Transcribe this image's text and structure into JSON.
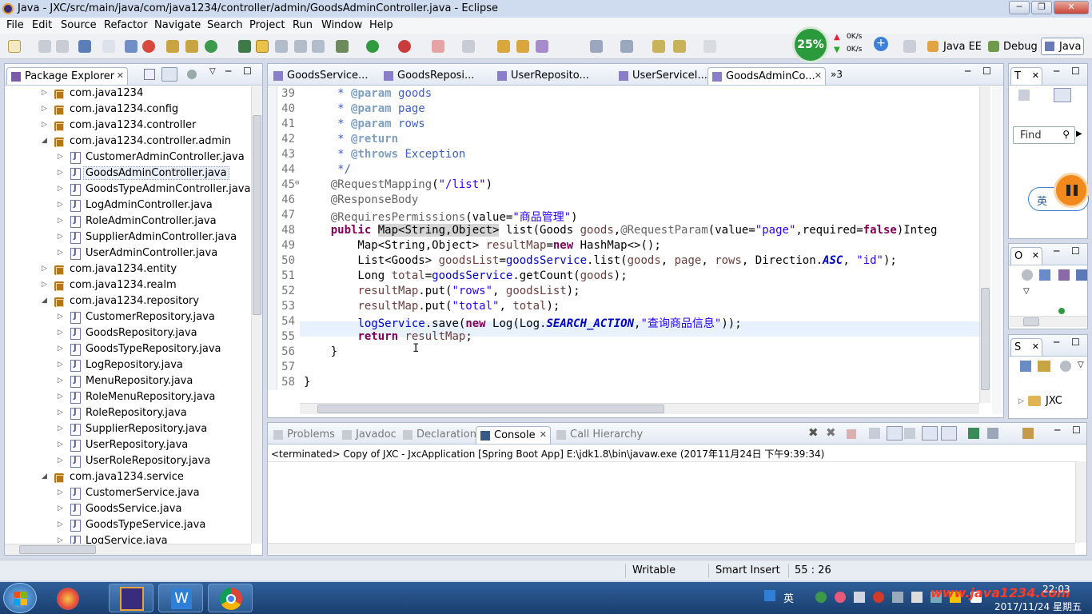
{
  "window": {
    "title": "Java - JXC/src/main/java/com/java1234/controller/admin/GoodsAdminController.java - Eclipse"
  },
  "menus": [
    "File",
    "Edit",
    "Source",
    "Refactor",
    "Navigate",
    "Search",
    "Project",
    "Run",
    "Window",
    "Help"
  ],
  "network": {
    "cpu": "25%",
    "up": "0K/s",
    "down": "0K/s"
  },
  "perspectives": {
    "javaee": "Java EE",
    "debug": "Debug",
    "java": "Java"
  },
  "package_explorer": {
    "title": "Package Explorer",
    "items": [
      {
        "label": "com.java1234",
        "kind": "pkg",
        "expanded": false
      },
      {
        "label": "com.java1234.config",
        "kind": "pkg",
        "expanded": false
      },
      {
        "label": "com.java1234.controller",
        "kind": "pkg",
        "expanded": false
      },
      {
        "label": "com.java1234.controller.admin",
        "kind": "pkg",
        "expanded": true
      },
      {
        "label": "CustomerAdminController.java",
        "kind": "file"
      },
      {
        "label": "GoodsAdminController.java",
        "kind": "file",
        "selected": true
      },
      {
        "label": "GoodsTypeAdminController.java",
        "kind": "file"
      },
      {
        "label": "LogAdminController.java",
        "kind": "file"
      },
      {
        "label": "RoleAdminController.java",
        "kind": "file"
      },
      {
        "label": "SupplierAdminController.java",
        "kind": "file"
      },
      {
        "label": "UserAdminController.java",
        "kind": "file"
      },
      {
        "label": "com.java1234.entity",
        "kind": "pkg",
        "expanded": false
      },
      {
        "label": "com.java1234.realm",
        "kind": "pkg",
        "expanded": false
      },
      {
        "label": "com.java1234.repository",
        "kind": "pkg",
        "expanded": true
      },
      {
        "label": "CustomerRepository.java",
        "kind": "file"
      },
      {
        "label": "GoodsRepository.java",
        "kind": "file"
      },
      {
        "label": "GoodsTypeRepository.java",
        "kind": "file"
      },
      {
        "label": "LogRepository.java",
        "kind": "file"
      },
      {
        "label": "MenuRepository.java",
        "kind": "file"
      },
      {
        "label": "RoleMenuRepository.java",
        "kind": "file"
      },
      {
        "label": "RoleRepository.java",
        "kind": "file"
      },
      {
        "label": "SupplierRepository.java",
        "kind": "file"
      },
      {
        "label": "UserRepository.java",
        "kind": "file"
      },
      {
        "label": "UserRoleRepository.java",
        "kind": "file"
      },
      {
        "label": "com.java1234.service",
        "kind": "pkg",
        "expanded": true
      },
      {
        "label": "CustomerService.java",
        "kind": "file"
      },
      {
        "label": "GoodsService.java",
        "kind": "file"
      },
      {
        "label": "GoodsTypeService.java",
        "kind": "file"
      },
      {
        "label": "LogService.java",
        "kind": "file"
      }
    ]
  },
  "editor": {
    "tabs": [
      "GoodsService...",
      "GoodsReposi...",
      "UserReposito...",
      "UserServiceI...",
      "GoodsAdminCo..."
    ],
    "overflow": "»3",
    "lines": [
      {
        "n": "39",
        "html": "     <span class=\"jd\">* </span><span class=\"jdt\">@param</span><span class=\"jd\"> goods</span>"
      },
      {
        "n": "40",
        "html": "     <span class=\"jd\">* </span><span class=\"jdt\">@param</span><span class=\"jd\"> page</span>"
      },
      {
        "n": "41",
        "html": "     <span class=\"jd\">* </span><span class=\"jdt\">@param</span><span class=\"jd\"> rows</span>"
      },
      {
        "n": "42",
        "html": "     <span class=\"jd\">* </span><span class=\"jdt\">@return</span>"
      },
      {
        "n": "43",
        "html": "     <span class=\"jd\">* </span><span class=\"jdt\">@throws</span><span class=\"jd\"> Exception</span>"
      },
      {
        "n": "44",
        "html": "     <span class=\"jd\">*/</span>"
      },
      {
        "n": "45",
        "html": "    <span class=\"ann\">@RequestMapping</span>(<span class=\"str\">\"/list\"</span>)"
      },
      {
        "n": "46",
        "html": "    <span class=\"ann\">@ResponseBody</span>"
      },
      {
        "n": "47",
        "html": "    <span class=\"ann\">@RequiresPermissions</span>(value=<span class=\"str\">\"商品管理\"</span>)"
      },
      {
        "n": "48",
        "html": "    <span class=\"kw\">public</span> <span class=\"hl\">Map&lt;String,Object&gt;</span> list(Goods <span class=\"var\">goods</span>,<span class=\"ann\">@RequestParam</span>(value=<span class=\"str\">\"page\"</span>,required=<span class=\"kw\">false</span>)Integ"
      },
      {
        "n": "49",
        "html": "        Map&lt;String,Object&gt; <span class=\"var\">resultMap</span>=<span class=\"kw\">new</span> HashMap&lt;&gt;();"
      },
      {
        "n": "50",
        "html": "        List&lt;Goods&gt; <span class=\"var\">goodsList</span>=<span class=\"fld\">goodsService</span>.list(<span class=\"var\">goods</span>, <span class=\"var\">page</span>, <span class=\"var\">rows</span>, Direction.<span class=\"sfld\">ASC</span>, <span class=\"str\">\"id\"</span>);"
      },
      {
        "n": "51",
        "html": "        Long <span class=\"var\">total</span>=<span class=\"fld\">goodsService</span>.getCount(<span class=\"var\">goods</span>);"
      },
      {
        "n": "52",
        "html": "        <span class=\"var\">resultMap</span>.put(<span class=\"str\">\"rows\"</span>, <span class=\"var\">goodsList</span>);"
      },
      {
        "n": "53",
        "html": "        <span class=\"var\">resultMap</span>.put(<span class=\"str\">\"total\"</span>, <span class=\"var\">total</span>);"
      },
      {
        "n": "54",
        "html": "        <span class=\"fld\">logService</span>.save(<span class=\"kw\">new</span> Log(Log.<span class=\"sfld\">SEARCH_ACTION</span>,<span class=\"str\">\"查询商品信息\"</span>));"
      },
      {
        "n": "55",
        "html": "        <span class=\"kw\">return</span> <span class=\"var\">resultMap</span>;"
      },
      {
        "n": "56",
        "html": "    }"
      },
      {
        "n": "57",
        "html": ""
      },
      {
        "n": "58",
        "html": "}"
      },
      {
        "n": "59",
        "html": ""
      }
    ]
  },
  "bottom_panel": {
    "tabs": [
      "Problems",
      "Javadoc",
      "Declaration",
      "Console",
      "Call Hierarchy"
    ],
    "active": "Console",
    "console_header": "<terminated> Copy of JXC - JxcApplication [Spring Boot App] E:\\jdk1.8\\bin\\javaw.exe (2017年11月24日 下午9:39:34)"
  },
  "right_panels": {
    "task_title": "T",
    "find_label": "Find",
    "outline_title": "O",
    "servers_title": "S",
    "servers_item": "JXC",
    "ime_label": "英"
  },
  "status": {
    "writable": "Writable",
    "insert": "Smart Insert",
    "position": "55 : 26"
  },
  "taskbar": {
    "tray_ime": "英",
    "time": "22:03",
    "date": "2017/11/24 星期五",
    "watermark": "www.java1234.com"
  }
}
